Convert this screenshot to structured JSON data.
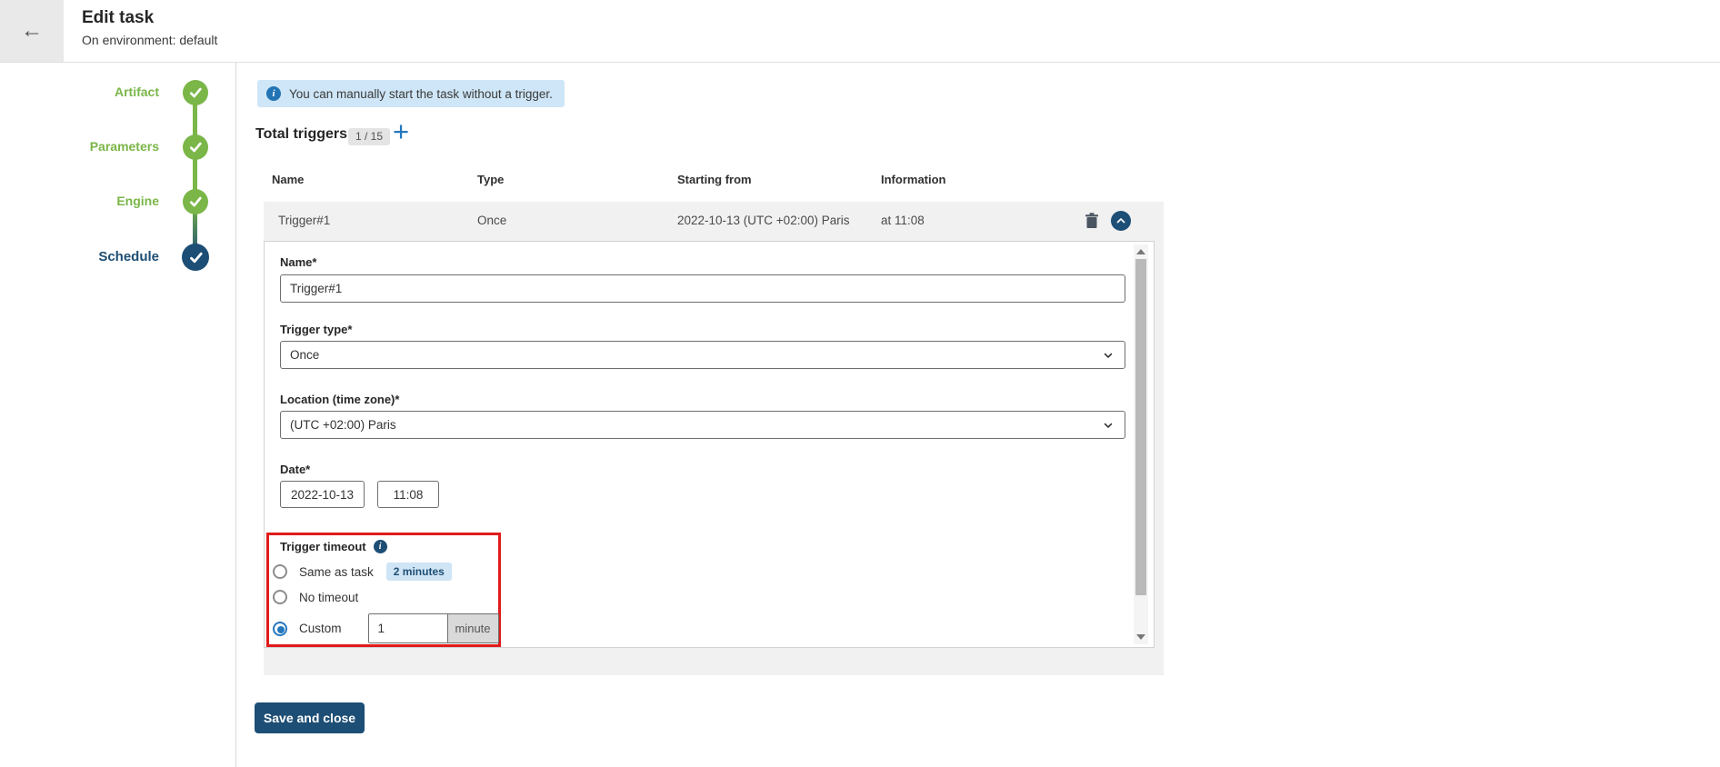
{
  "header": {
    "title": "Edit task",
    "subtitle": "On environment: default",
    "back_icon": "←"
  },
  "stepper": {
    "steps": [
      {
        "label": "Artifact",
        "state": "complete"
      },
      {
        "label": "Parameters",
        "state": "complete"
      },
      {
        "label": "Engine",
        "state": "complete"
      },
      {
        "label": "Schedule",
        "state": "active"
      }
    ]
  },
  "banner": {
    "text": "You can manually start the task without a trigger."
  },
  "triggers_section": {
    "title": "Total triggers",
    "count_badge": "1 / 15",
    "add_icon": "+"
  },
  "table": {
    "headers": [
      "Name",
      "Type",
      "Starting from",
      "Information"
    ]
  },
  "trigger_row": {
    "name": "Trigger#1",
    "type": "Once",
    "starting_from": "2022-10-13 (UTC +02:00) Paris",
    "information": "at 11:08"
  },
  "form": {
    "name": {
      "label": "Name*",
      "value": "Trigger#1"
    },
    "trigger_type": {
      "label": "Trigger type*",
      "value": "Once"
    },
    "location": {
      "label": "Location (time zone)*",
      "value": "(UTC +02:00) Paris"
    },
    "date": {
      "label": "Date*",
      "date_value": "2022-10-13",
      "time_value": "11:08"
    },
    "timeout": {
      "label": "Trigger timeout",
      "options": [
        {
          "label": "Same as task",
          "badge": "2 minutes",
          "selected": false
        },
        {
          "label": "No timeout",
          "selected": false
        },
        {
          "label": "Custom",
          "selected": true,
          "value": "1",
          "unit": "minute"
        }
      ]
    }
  },
  "footer": {
    "save_label": "Save and close"
  },
  "colors": {
    "step_complete_green": "#7ab648",
    "step_active_navy": "#1d4e75",
    "accent_blue": "#2478be",
    "banner_bg": "#cee6f7",
    "highlight_red": "#e11b1b",
    "card_bg": "#f1f1f1"
  }
}
